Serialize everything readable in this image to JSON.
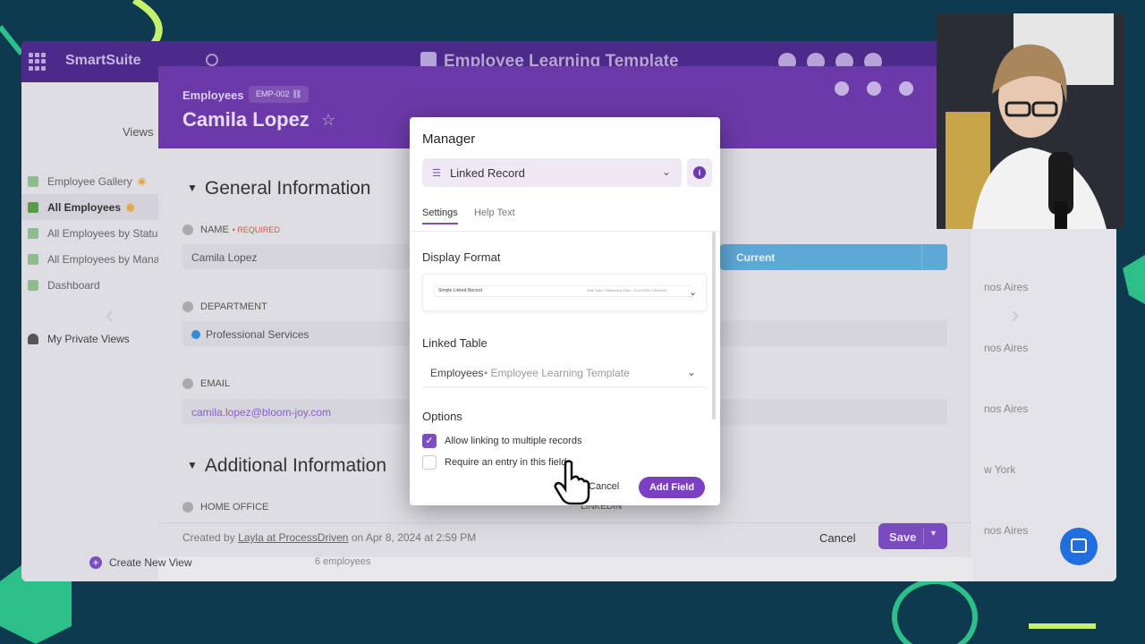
{
  "topbar": {
    "brand": "SmartSuite",
    "app_title": "Employee Learning Template"
  },
  "sidebar": {
    "views_label": "Views",
    "items": [
      {
        "label": "Employee Gallery"
      },
      {
        "label": "All Employees"
      },
      {
        "label": "All Employees by Status"
      },
      {
        "label": "All Employees by Manager"
      },
      {
        "label": "Dashboard"
      }
    ],
    "private_label": "My Private Views",
    "create_label": "Create New View"
  },
  "grid": {
    "cells": [
      "nos Aires",
      "nos Aires",
      "nos Aires",
      "w York",
      "nos Aires"
    ],
    "count": "6 employees"
  },
  "record": {
    "breadcrumb": "Employees",
    "badge": "EMP-002",
    "name": "Camila Lopez",
    "sections": {
      "general": "General Information",
      "additional": "Additional Information"
    },
    "fields": {
      "name_label": "NAME",
      "required": "• REQUIRED",
      "name_value": "Camila Lopez",
      "department_label": "DEPARTMENT",
      "department_value": "Professional Services",
      "email_label": "EMAIL",
      "email_value": "camila.lopez@bloom-joy.com",
      "home_office_label": "HOME OFFICE",
      "linkedin_label": "LINKEDIN",
      "status_value": "Current"
    },
    "footer": {
      "created_by": "Created",
      "created_by_word": "by",
      "author": "Layla at ProcessDriven",
      "on_word": "on",
      "date": "Apr 8, 2024 at 2:59 PM",
      "cancel": "Cancel",
      "save": "Save"
    }
  },
  "dialog": {
    "title": "Manager",
    "field_type": "Linked Record",
    "tabs": [
      "Settings",
      "Help Text"
    ],
    "display_format_label": "Display Format",
    "format_preview_name": "Simple Linked Record",
    "format_preview_sub": "Seth Tyler • Marketing Plan • 11/22/2020 • $98,000",
    "linked_table_label": "Linked Table",
    "linked_table_primary": "Employees",
    "linked_table_secondary": "• Employee Learning Template",
    "options_label": "Options",
    "options": [
      {
        "label": "Allow linking to multiple records",
        "checked": true
      },
      {
        "label": "Require an entry in this field",
        "checked": false
      }
    ],
    "cancel": "Cancel",
    "add_field": "Add Field"
  },
  "colors": {
    "accent": "#7b3fc4",
    "header": "#6b3aa8",
    "status": "#5ea8d6"
  }
}
